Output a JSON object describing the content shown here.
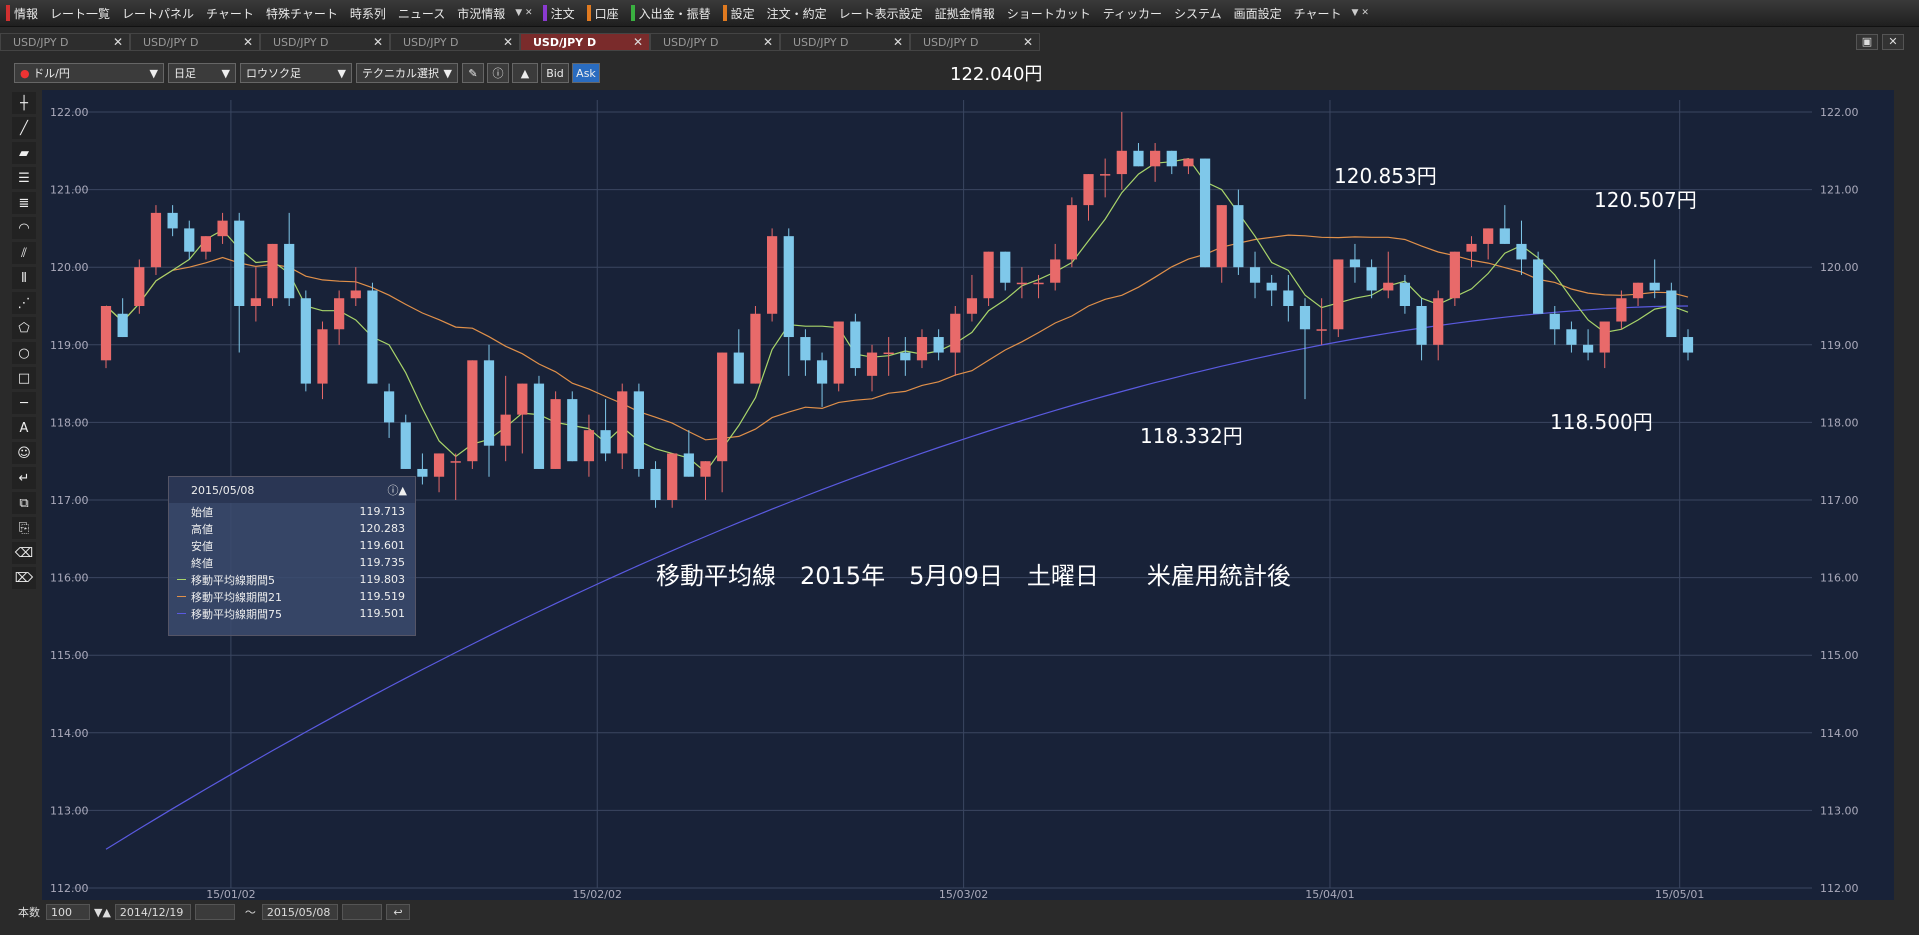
{
  "menubar": {
    "items": [
      {
        "label": "情報",
        "accent": "#d03030"
      },
      {
        "label": "レート一覧"
      },
      {
        "label": "レートパネル"
      },
      {
        "label": "チャート"
      },
      {
        "label": "特殊チャート"
      },
      {
        "label": "時系列"
      },
      {
        "label": "ニュース"
      },
      {
        "label": "市況情報"
      }
    ],
    "order_label": "注文",
    "account_label": "口座",
    "deposit_label": "入出金・振替",
    "settings_items": [
      {
        "label": "設定"
      },
      {
        "label": "注文・約定"
      },
      {
        "label": "レート表示設定"
      },
      {
        "label": "証拠金情報"
      },
      {
        "label": "ショートカット"
      },
      {
        "label": "ティッカー"
      },
      {
        "label": "システム"
      },
      {
        "label": "画面設定"
      },
      {
        "label": "チャート"
      }
    ]
  },
  "tabs": [
    {
      "label": "USD/JPY D",
      "active": false
    },
    {
      "label": "USD/JPY D",
      "active": false
    },
    {
      "label": "USD/JPY D",
      "active": false
    },
    {
      "label": "USD/JPY D",
      "active": false
    },
    {
      "label": "USD/JPY D",
      "active": true
    },
    {
      "label": "USD/JPY D",
      "active": false
    },
    {
      "label": "USD/JPY D",
      "active": false
    },
    {
      "label": "USD/JPY D",
      "active": false
    }
  ],
  "toolbar": {
    "pair": "ドル/円",
    "period": "日足",
    "chart_style": "ロウソク足",
    "technical": "テクニカル選択",
    "bid_label": "Bid",
    "ask_label": "Ask"
  },
  "current_price": "122.040円",
  "infobox": {
    "date": "2015/05/08",
    "rows": [
      {
        "label": "始値",
        "value": "119.713"
      },
      {
        "label": "高値",
        "value": "120.283"
      },
      {
        "label": "安値",
        "value": "119.601"
      },
      {
        "label": "終値",
        "value": "119.735"
      },
      {
        "label": "移動平均線期間5",
        "value": "119.803",
        "color": "#a8d46a"
      },
      {
        "label": "移動平均線期間21",
        "value": "119.519",
        "color": "#e0904a"
      },
      {
        "label": "移動平均線期間75",
        "value": "119.501",
        "color": "#5a5ae0"
      }
    ]
  },
  "annotations": {
    "high1": "120.853円",
    "high2": "120.507円",
    "low1": "118.332円",
    "low2": "118.500円",
    "caption": "移動平均線　2015年　5月09日　土曜日　　米雇用統計後"
  },
  "bottombar": {
    "count_label": "本数",
    "count_value": "100",
    "from_date": "2014/12/19",
    "tilde": "～",
    "to_date": "2015/05/08"
  },
  "chart_data": {
    "type": "candlestick",
    "title": "",
    "ylim": [
      112.0,
      122.0
    ],
    "yticks": [
      "112.00",
      "113.00",
      "114.00",
      "115.00",
      "116.00",
      "117.00",
      "118.00",
      "119.00",
      "120.00",
      "121.00",
      "122.00"
    ],
    "xticks": [
      "15/01/02",
      "15/02/02",
      "15/03/02",
      "15/04/01",
      "15/05/01"
    ],
    "colors": {
      "up": "#e86a6a",
      "down": "#7fc8ea",
      "ma5": "#a8d46a",
      "ma21": "#e0904a",
      "ma75": "#5a5ae0",
      "grid": "#3a4660",
      "bg": "#182238"
    },
    "candles": [
      [
        118.8,
        119.5,
        118.7,
        119.5
      ],
      [
        119.4,
        119.6,
        119.1,
        119.1
      ],
      [
        119.5,
        120.1,
        119.4,
        120.0
      ],
      [
        120.0,
        120.8,
        119.9,
        120.7
      ],
      [
        120.7,
        120.8,
        120.4,
        120.5
      ],
      [
        120.5,
        120.6,
        120.1,
        120.2
      ],
      [
        120.2,
        120.4,
        120.1,
        120.4
      ],
      [
        120.4,
        120.7,
        120.3,
        120.6
      ],
      [
        120.6,
        120.7,
        118.9,
        119.5
      ],
      [
        119.5,
        120.0,
        119.3,
        119.6
      ],
      [
        119.6,
        120.3,
        119.5,
        120.3
      ],
      [
        120.3,
        120.7,
        119.5,
        119.6
      ],
      [
        119.6,
        119.7,
        118.4,
        118.5
      ],
      [
        118.5,
        119.3,
        118.3,
        119.2
      ],
      [
        119.2,
        119.7,
        119.0,
        119.6
      ],
      [
        119.6,
        120.0,
        119.5,
        119.7
      ],
      [
        119.7,
        119.8,
        118.5,
        118.5
      ],
      [
        118.4,
        118.5,
        117.8,
        118.0
      ],
      [
        118.0,
        118.1,
        117.4,
        117.4
      ],
      [
        117.4,
        117.6,
        117.2,
        117.3
      ],
      [
        117.3,
        117.6,
        117.1,
        117.6
      ],
      [
        117.5,
        117.6,
        117.0,
        117.5
      ],
      [
        117.5,
        118.8,
        117.4,
        118.8
      ],
      [
        118.8,
        119.0,
        117.3,
        117.7
      ],
      [
        117.7,
        118.6,
        117.5,
        118.1
      ],
      [
        118.1,
        118.5,
        117.6,
        118.5
      ],
      [
        118.5,
        118.6,
        117.4,
        117.4
      ],
      [
        117.4,
        118.4,
        117.4,
        118.3
      ],
      [
        118.3,
        118.4,
        117.5,
        117.5
      ],
      [
        117.5,
        118.1,
        117.3,
        117.9
      ],
      [
        117.9,
        118.3,
        117.5,
        117.6
      ],
      [
        117.6,
        118.5,
        117.4,
        118.4
      ],
      [
        118.4,
        118.5,
        117.3,
        117.4
      ],
      [
        117.4,
        117.5,
        116.9,
        117.0
      ],
      [
        117.0,
        117.6,
        116.9,
        117.6
      ],
      [
        117.6,
        117.9,
        117.3,
        117.3
      ],
      [
        117.3,
        117.5,
        117.0,
        117.5
      ],
      [
        117.5,
        118.9,
        117.1,
        118.9
      ],
      [
        118.9,
        119.2,
        118.5,
        118.5
      ],
      [
        118.5,
        119.5,
        118.5,
        119.4
      ],
      [
        119.4,
        120.5,
        119.3,
        120.4
      ],
      [
        120.4,
        120.5,
        118.6,
        119.1
      ],
      [
        119.1,
        119.2,
        118.6,
        118.8
      ],
      [
        118.8,
        118.9,
        118.2,
        118.5
      ],
      [
        118.5,
        119.3,
        118.4,
        119.3
      ],
      [
        119.3,
        119.4,
        118.6,
        118.7
      ],
      [
        118.6,
        119.0,
        118.4,
        118.9
      ],
      [
        118.9,
        119.1,
        118.6,
        118.9
      ],
      [
        118.9,
        119.1,
        118.6,
        118.8
      ],
      [
        118.8,
        119.2,
        118.7,
        119.1
      ],
      [
        119.1,
        119.2,
        118.8,
        118.9
      ],
      [
        118.9,
        119.5,
        118.6,
        119.4
      ],
      [
        119.4,
        119.9,
        119.3,
        119.6
      ],
      [
        119.6,
        120.2,
        119.5,
        120.2
      ],
      [
        120.2,
        120.2,
        119.7,
        119.8
      ],
      [
        119.8,
        120.0,
        119.6,
        119.8
      ],
      [
        119.8,
        119.9,
        119.6,
        119.8
      ],
      [
        119.8,
        120.3,
        119.7,
        120.1
      ],
      [
        120.1,
        120.9,
        120.0,
        120.8
      ],
      [
        120.8,
        121.2,
        120.6,
        121.2
      ],
      [
        121.2,
        121.4,
        120.9,
        121.2
      ],
      [
        121.2,
        122.0,
        121.0,
        121.5
      ],
      [
        121.5,
        121.6,
        121.3,
        121.3
      ],
      [
        121.3,
        121.6,
        121.1,
        121.5
      ],
      [
        121.5,
        121.5,
        121.2,
        121.3
      ],
      [
        121.3,
        121.4,
        121.2,
        121.4
      ],
      [
        121.4,
        121.4,
        120.0,
        120.0
      ],
      [
        120.0,
        120.8,
        119.8,
        120.8
      ],
      [
        120.8,
        121.0,
        119.9,
        120.0
      ],
      [
        120.0,
        120.2,
        119.6,
        119.8
      ],
      [
        119.8,
        119.9,
        119.5,
        119.7
      ],
      [
        119.7,
        119.9,
        119.3,
        119.5
      ],
      [
        119.5,
        119.6,
        118.3,
        119.2
      ],
      [
        119.2,
        119.6,
        119.0,
        119.2
      ],
      [
        119.2,
        120.1,
        119.1,
        120.1
      ],
      [
        120.1,
        120.3,
        119.8,
        120.0
      ],
      [
        120.0,
        120.1,
        119.6,
        119.7
      ],
      [
        119.7,
        120.2,
        119.6,
        119.8
      ],
      [
        119.8,
        119.9,
        119.4,
        119.5
      ],
      [
        119.5,
        119.6,
        118.8,
        119.0
      ],
      [
        119.0,
        119.7,
        118.8,
        119.6
      ],
      [
        119.6,
        120.2,
        119.5,
        120.2
      ],
      [
        120.2,
        120.4,
        120.0,
        120.3
      ],
      [
        120.3,
        120.5,
        120.1,
        120.5
      ],
      [
        120.5,
        120.8,
        120.3,
        120.3
      ],
      [
        120.3,
        120.6,
        119.9,
        120.1
      ],
      [
        120.1,
        120.2,
        119.4,
        119.4
      ],
      [
        119.4,
        119.5,
        119.0,
        119.2
      ],
      [
        119.2,
        119.3,
        118.9,
        119.0
      ],
      [
        119.0,
        119.2,
        118.8,
        118.9
      ],
      [
        118.9,
        119.3,
        118.7,
        119.3
      ],
      [
        119.3,
        119.7,
        119.2,
        119.6
      ],
      [
        119.6,
        119.8,
        119.5,
        119.8
      ],
      [
        119.8,
        120.1,
        119.6,
        119.7
      ],
      [
        119.7,
        119.8,
        119.3,
        119.1
      ],
      [
        119.1,
        119.2,
        118.8,
        118.9
      ]
    ],
    "ma75_start": 112.5,
    "ma75_end": 119.5
  }
}
